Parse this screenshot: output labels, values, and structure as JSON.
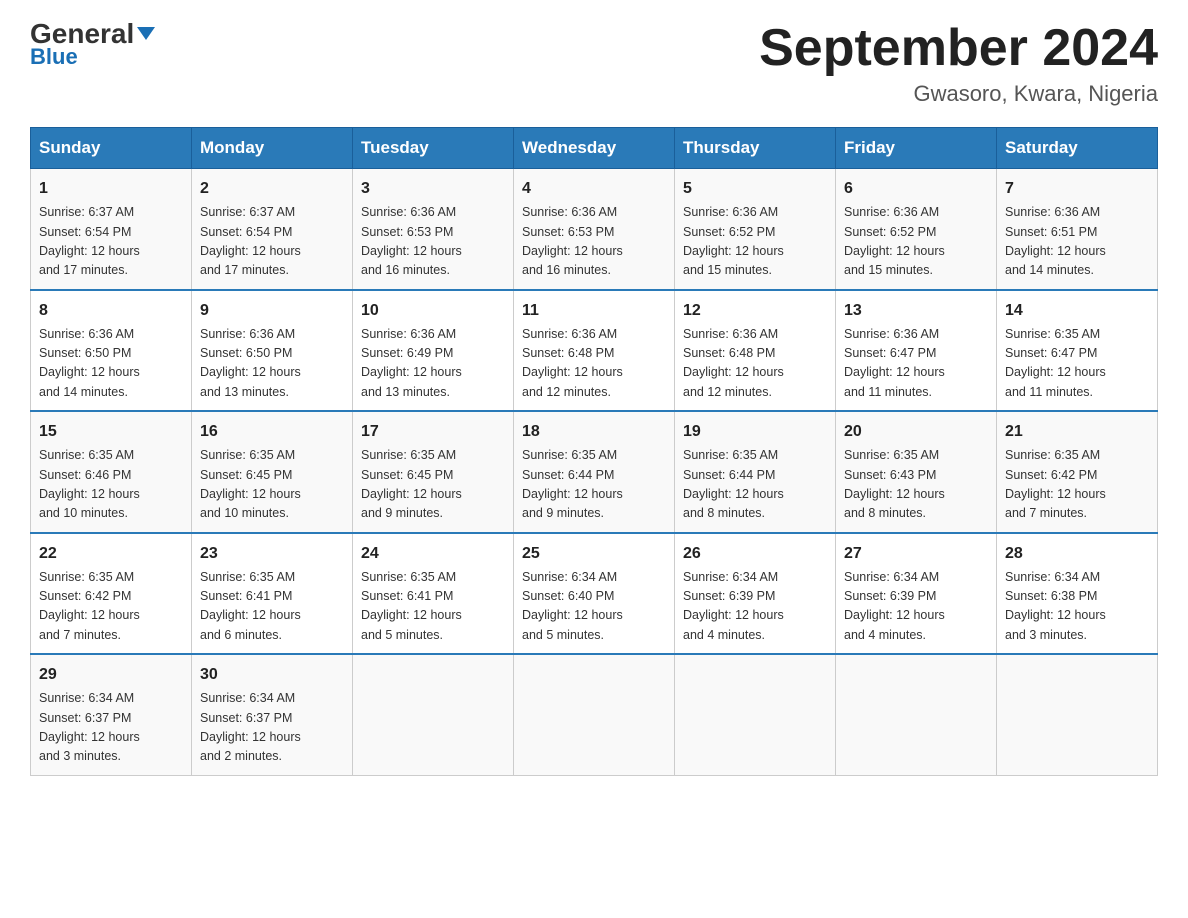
{
  "header": {
    "logo_text1": "General",
    "logo_text2": "Blue",
    "title": "September 2024",
    "subtitle": "Gwasoro, Kwara, Nigeria"
  },
  "days_of_week": [
    "Sunday",
    "Monday",
    "Tuesday",
    "Wednesday",
    "Thursday",
    "Friday",
    "Saturday"
  ],
  "weeks": [
    [
      {
        "day": "1",
        "sunrise": "6:37 AM",
        "sunset": "6:54 PM",
        "daylight": "12 hours and 17 minutes."
      },
      {
        "day": "2",
        "sunrise": "6:37 AM",
        "sunset": "6:54 PM",
        "daylight": "12 hours and 17 minutes."
      },
      {
        "day": "3",
        "sunrise": "6:36 AM",
        "sunset": "6:53 PM",
        "daylight": "12 hours and 16 minutes."
      },
      {
        "day": "4",
        "sunrise": "6:36 AM",
        "sunset": "6:53 PM",
        "daylight": "12 hours and 16 minutes."
      },
      {
        "day": "5",
        "sunrise": "6:36 AM",
        "sunset": "6:52 PM",
        "daylight": "12 hours and 15 minutes."
      },
      {
        "day": "6",
        "sunrise": "6:36 AM",
        "sunset": "6:52 PM",
        "daylight": "12 hours and 15 minutes."
      },
      {
        "day": "7",
        "sunrise": "6:36 AM",
        "sunset": "6:51 PM",
        "daylight": "12 hours and 14 minutes."
      }
    ],
    [
      {
        "day": "8",
        "sunrise": "6:36 AM",
        "sunset": "6:50 PM",
        "daylight": "12 hours and 14 minutes."
      },
      {
        "day": "9",
        "sunrise": "6:36 AM",
        "sunset": "6:50 PM",
        "daylight": "12 hours and 13 minutes."
      },
      {
        "day": "10",
        "sunrise": "6:36 AM",
        "sunset": "6:49 PM",
        "daylight": "12 hours and 13 minutes."
      },
      {
        "day": "11",
        "sunrise": "6:36 AM",
        "sunset": "6:48 PM",
        "daylight": "12 hours and 12 minutes."
      },
      {
        "day": "12",
        "sunrise": "6:36 AM",
        "sunset": "6:48 PM",
        "daylight": "12 hours and 12 minutes."
      },
      {
        "day": "13",
        "sunrise": "6:36 AM",
        "sunset": "6:47 PM",
        "daylight": "12 hours and 11 minutes."
      },
      {
        "day": "14",
        "sunrise": "6:35 AM",
        "sunset": "6:47 PM",
        "daylight": "12 hours and 11 minutes."
      }
    ],
    [
      {
        "day": "15",
        "sunrise": "6:35 AM",
        "sunset": "6:46 PM",
        "daylight": "12 hours and 10 minutes."
      },
      {
        "day": "16",
        "sunrise": "6:35 AM",
        "sunset": "6:45 PM",
        "daylight": "12 hours and 10 minutes."
      },
      {
        "day": "17",
        "sunrise": "6:35 AM",
        "sunset": "6:45 PM",
        "daylight": "12 hours and 9 minutes."
      },
      {
        "day": "18",
        "sunrise": "6:35 AM",
        "sunset": "6:44 PM",
        "daylight": "12 hours and 9 minutes."
      },
      {
        "day": "19",
        "sunrise": "6:35 AM",
        "sunset": "6:44 PM",
        "daylight": "12 hours and 8 minutes."
      },
      {
        "day": "20",
        "sunrise": "6:35 AM",
        "sunset": "6:43 PM",
        "daylight": "12 hours and 8 minutes."
      },
      {
        "day": "21",
        "sunrise": "6:35 AM",
        "sunset": "6:42 PM",
        "daylight": "12 hours and 7 minutes."
      }
    ],
    [
      {
        "day": "22",
        "sunrise": "6:35 AM",
        "sunset": "6:42 PM",
        "daylight": "12 hours and 7 minutes."
      },
      {
        "day": "23",
        "sunrise": "6:35 AM",
        "sunset": "6:41 PM",
        "daylight": "12 hours and 6 minutes."
      },
      {
        "day": "24",
        "sunrise": "6:35 AM",
        "sunset": "6:41 PM",
        "daylight": "12 hours and 5 minutes."
      },
      {
        "day": "25",
        "sunrise": "6:34 AM",
        "sunset": "6:40 PM",
        "daylight": "12 hours and 5 minutes."
      },
      {
        "day": "26",
        "sunrise": "6:34 AM",
        "sunset": "6:39 PM",
        "daylight": "12 hours and 4 minutes."
      },
      {
        "day": "27",
        "sunrise": "6:34 AM",
        "sunset": "6:39 PM",
        "daylight": "12 hours and 4 minutes."
      },
      {
        "day": "28",
        "sunrise": "6:34 AM",
        "sunset": "6:38 PM",
        "daylight": "12 hours and 3 minutes."
      }
    ],
    [
      {
        "day": "29",
        "sunrise": "6:34 AM",
        "sunset": "6:37 PM",
        "daylight": "12 hours and 3 minutes."
      },
      {
        "day": "30",
        "sunrise": "6:34 AM",
        "sunset": "6:37 PM",
        "daylight": "12 hours and 2 minutes."
      },
      null,
      null,
      null,
      null,
      null
    ]
  ],
  "labels": {
    "sunrise_prefix": "Sunrise: ",
    "sunset_prefix": "Sunset: ",
    "daylight_prefix": "Daylight: "
  }
}
